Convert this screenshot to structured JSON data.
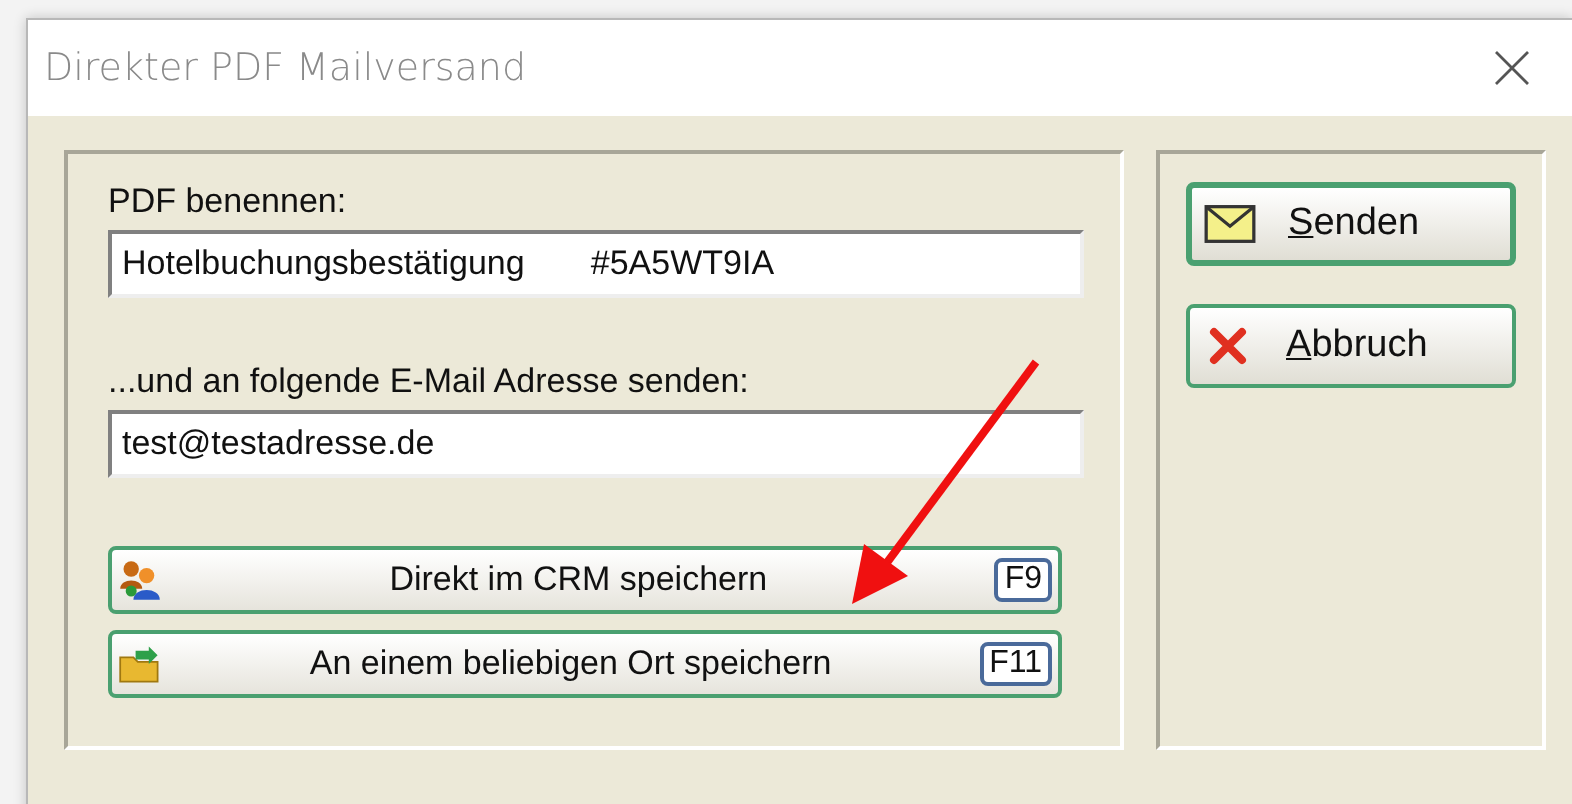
{
  "window": {
    "title": "Direkter PDF Mailversand"
  },
  "form": {
    "name_label": "PDF benennen:",
    "name_value": "Hotelbuchungsbestätigung       #5A5WT9IA",
    "email_label": "...und an folgende E-Mail Adresse senden:",
    "email_value": "test@testadresse.de"
  },
  "save_buttons": [
    {
      "kind": "crm",
      "label": "Direkt im CRM speichern",
      "key": "F9"
    },
    {
      "kind": "folder",
      "label": "An einem beliebigen Ort speichern",
      "key": "F11"
    }
  ],
  "actions": [
    {
      "kind": "send",
      "label": "Senden"
    },
    {
      "kind": "cancel",
      "label": "Abbruch"
    }
  ]
}
